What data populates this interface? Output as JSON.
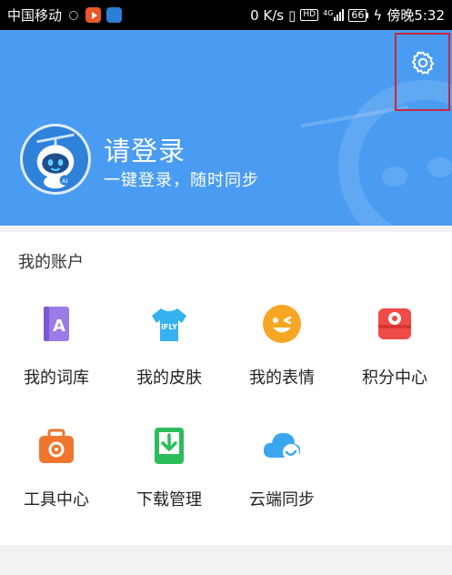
{
  "status_bar": {
    "carrier": "中国移动",
    "speed": "0 K/s",
    "hd_badge": "HD",
    "network": "4G",
    "battery": "66",
    "time": "傍晚5:32"
  },
  "header": {
    "login_title": "请登录",
    "login_subtitle": "一键登录，随时同步",
    "settings_icon": "gear-icon",
    "avatar_badge": "AI",
    "background_color": "#4a9cf2",
    "highlight_color": "#c8283a"
  },
  "account": {
    "section_title": "我的账户",
    "items": [
      {
        "label": "我的词库",
        "icon": "dictionary-icon"
      },
      {
        "label": "我的皮肤",
        "icon": "skin-tshirt-icon"
      },
      {
        "label": "我的表情",
        "icon": "emoji-face-icon"
      },
      {
        "label": "积分中心",
        "icon": "points-shop-icon"
      },
      {
        "label": "工具中心",
        "icon": "toolbox-icon"
      },
      {
        "label": "下载管理",
        "icon": "download-icon"
      },
      {
        "label": "云端同步",
        "icon": "cloud-sync-icon"
      }
    ],
    "skin_icon_text": "iFLY",
    "dictionary_icon_text": "A"
  }
}
